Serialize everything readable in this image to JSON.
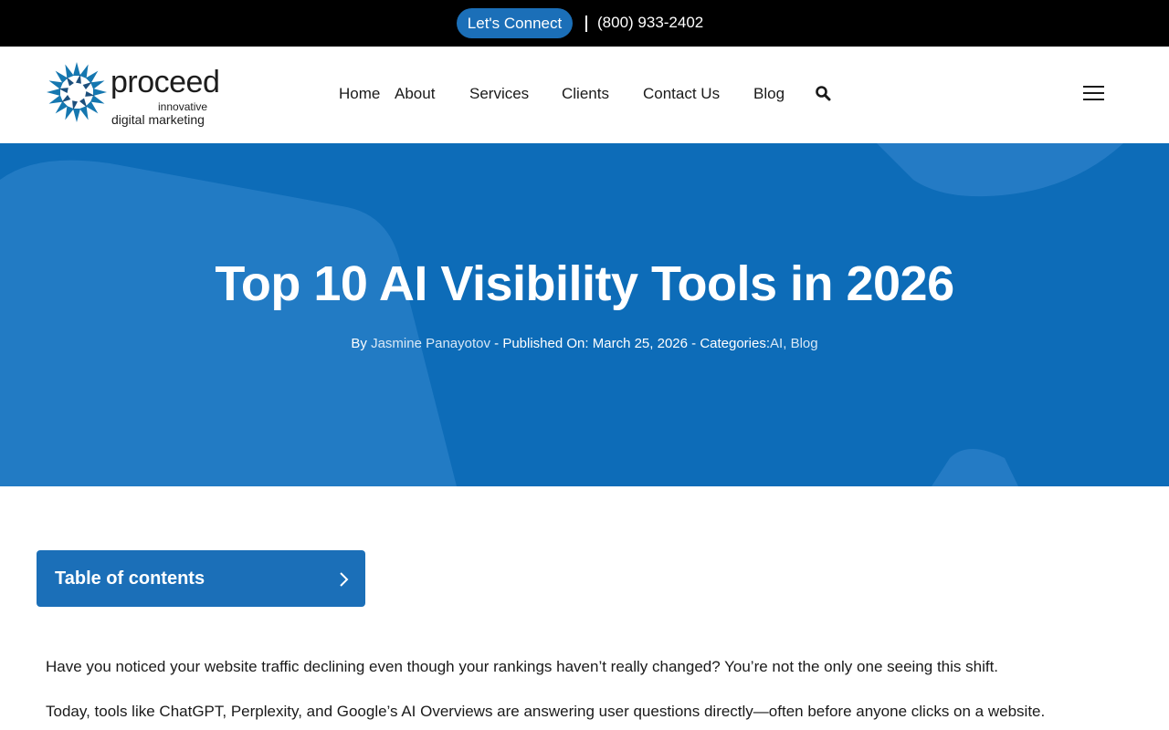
{
  "topbar": {
    "cta_label": "Let's Connect",
    "phone": "(800) 933-2402"
  },
  "header": {
    "logo": {
      "word": "proceed",
      "sub": "innovative",
      "tagline": "digital marketing"
    },
    "nav": [
      {
        "label": "Home"
      },
      {
        "label": "About"
      },
      {
        "label": "Services"
      },
      {
        "label": "Clients"
      },
      {
        "label": "Contact Us"
      },
      {
        "label": "Blog"
      }
    ],
    "search_icon": "search-icon",
    "menu_icon": "hamburger-menu-icon"
  },
  "hero": {
    "title": "Top 10 AI Visibility Tools in 2026",
    "meta": {
      "by_prefix": "By",
      "author": "Jasmine Panayotov",
      "sep1": "-",
      "published_prefix": "Published On:",
      "published_date": "March 25, 2026",
      "sep2": "-",
      "categories_prefix": "Categories:",
      "category_1": "AI",
      "category_sep": ",",
      "category_2": "Blog"
    }
  },
  "toc": {
    "label": "Table of contents",
    "icon": "chevron-right-icon"
  },
  "article": {
    "paragraphs": [
      "Have you noticed your website traffic declining even though your rankings haven’t really changed? You’re not the only one seeing this shift.",
      "Today, tools like ChatGPT, Perplexity, and Google’s AI Overviews are answering user questions directly—often before anyone clicks on a website."
    ]
  },
  "colors": {
    "topbar_bg": "#000000",
    "accent": "#1b6fb8",
    "hero_bg": "#0d6cb8",
    "text": "#1a1a1a"
  }
}
